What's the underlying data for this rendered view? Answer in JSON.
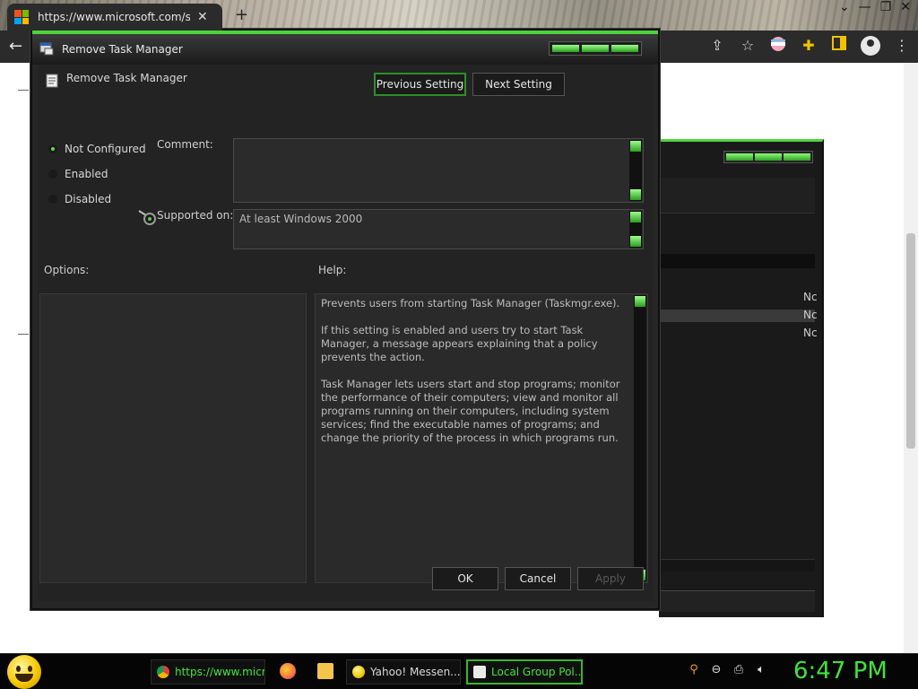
{
  "browser": {
    "tab_title": "https://www.microsoft.com/soft",
    "tab_close": "✕",
    "new_tab": "+",
    "back": "←",
    "window_controls": [
      "⌄",
      "—",
      "❐",
      "✕"
    ],
    "toolbar_icons": [
      "share-icon",
      "star-icon",
      "extension-icon",
      "puzzle-icon",
      "sidebar-icon",
      "profile-icon",
      "menu-icon"
    ]
  },
  "dialog": {
    "title": "Remove Task Manager",
    "setting_name": "Remove Task Manager",
    "prev_button": "Previous Setting",
    "next_button": "Next Setting",
    "radios": [
      {
        "label": "Not Configured",
        "selected": true
      },
      {
        "label": "Enabled",
        "selected": false
      },
      {
        "label": "Disabled",
        "selected": false
      }
    ],
    "comment_label": "Comment:",
    "comment_value": "",
    "supported_label": "Supported on:",
    "supported_value": "At least Windows 2000",
    "options_label": "Options:",
    "help_label": "Help:",
    "help_text": "Prevents users from starting Task Manager (Taskmgr.exe).\n\nIf this setting is enabled and users try to start Task Manager, a message appears explaining that a policy prevents the action.\n\nTask Manager lets users start and stop programs; monitor the performance of their computers; view and monitor all programs running on their computers, including system services; find the executable names of programs; and change the priority of the process in which programs run.",
    "ok": "OK",
    "cancel": "Cancel",
    "apply": "Apply"
  },
  "background_window": {
    "row_texts": [
      "Nc",
      "Nc",
      "Nc"
    ]
  },
  "taskbar": {
    "items": [
      {
        "label": "https://www.micr...",
        "icon": "chrome-icon",
        "active": false
      },
      {
        "label": "Yahoo! Messen...",
        "icon": "yahoo-messenger-icon",
        "active": false
      },
      {
        "label": "Local Group Pol...",
        "icon": "group-policy-icon",
        "active": true
      }
    ],
    "quick_launch": [
      "firefox-icon",
      "folder-icon"
    ],
    "tray_icons": [
      "search-icon",
      "minus-circle-icon",
      "network-icon",
      "volume-icon"
    ],
    "clock": "6:47 PM"
  },
  "colors": {
    "accent_green": "#4ed33d",
    "clock_green": "#3ee636",
    "dialog_bg": "#262626"
  }
}
